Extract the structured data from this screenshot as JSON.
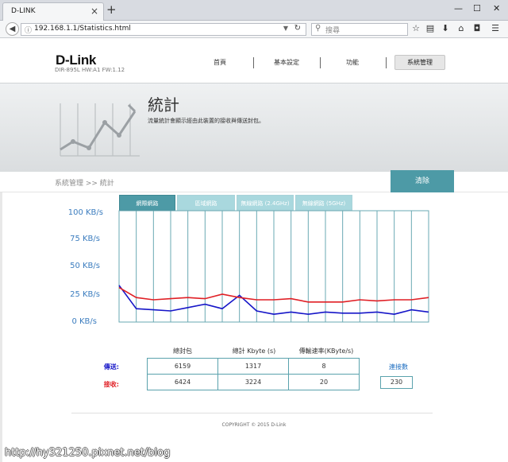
{
  "browser": {
    "tab_title": "D-LINK",
    "tab_close": "×",
    "new_tab": "+",
    "window_controls": [
      "—",
      "☐",
      "✕"
    ],
    "back_icon": "arrow-left-icon",
    "url": "192.168.1.1/Statistics.html",
    "search_placeholder": "搜尋",
    "toolbar_icons": [
      "star-icon",
      "clipboard-icon",
      "download-icon",
      "home-icon",
      "pocket-icon",
      "menu-icon"
    ]
  },
  "router": {
    "logo": "D-Link",
    "model": "DIR-895L HW:A1 FW:1.12",
    "nav": [
      "首頁",
      "基本設定",
      "功能",
      "系統管理"
    ],
    "active_nav": "系統管理",
    "page_title": "統計",
    "page_desc": "流量統計會顯示經由此裝置的接收與傳送封包。",
    "breadcrumb": "系統管理 >> 統計",
    "clear_label": "清除",
    "tabs": [
      "網際網路",
      "區域網路",
      "無線網路 (2.4GHz)",
      "無線網路 (5GHz)"
    ],
    "active_tab": "網際網路"
  },
  "chart_data": {
    "type": "line",
    "y_ticks": [
      "100 KB/s",
      "75 KB/s",
      "50 KB/s",
      "25 KB/s",
      "0 KB/s"
    ],
    "ylim": [
      0,
      100
    ],
    "grid": true,
    "series": [
      {
        "name": "傳送",
        "color": "#1616c8",
        "values": [
          33,
          12,
          11,
          10,
          13,
          16,
          12,
          24,
          10,
          7,
          9,
          7,
          9,
          8,
          8,
          9,
          7,
          11,
          9
        ]
      },
      {
        "name": "接收",
        "color": "#e01f25",
        "values": [
          31,
          22,
          20,
          21,
          22,
          21,
          25,
          22,
          20,
          20,
          21,
          18,
          18,
          18,
          20,
          19,
          20,
          20,
          22
        ]
      }
    ]
  },
  "stats": {
    "headers": [
      "總封包",
      "總計 Kbyte (s)",
      "傳輸速率(KByte/s)"
    ],
    "rows": [
      {
        "label": "傳送:",
        "color": "#1616c8",
        "packets": "6159",
        "kbytes": "1317",
        "rate": "8"
      },
      {
        "label": "接收:",
        "color": "#e01f25",
        "packets": "6424",
        "kbytes": "3224",
        "rate": "20"
      }
    ],
    "connections_label": "連接數",
    "connections": "230"
  },
  "copyright": "COPYRIGHT © 2015 D-Link",
  "watermark": "http://hy321250.pixnet.net/blog"
}
